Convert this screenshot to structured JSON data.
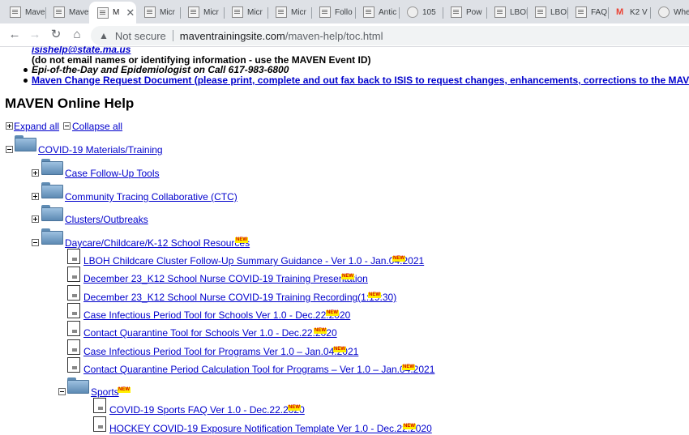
{
  "tabs": [
    {
      "label": "Mave",
      "icon": "maven-favicon-icon"
    },
    {
      "label": "Mave",
      "icon": "maven-favicon-icon"
    },
    {
      "label": "M",
      "icon": "maven-favicon-icon",
      "active": true
    },
    {
      "label": "Micr",
      "icon": "maven-favicon-icon"
    },
    {
      "label": "Micr",
      "icon": "maven-favicon-icon"
    },
    {
      "label": "Micr",
      "icon": "maven-favicon-icon"
    },
    {
      "label": "Micr",
      "icon": "maven-favicon-icon"
    },
    {
      "label": "Follo",
      "icon": "maven-favicon-icon"
    },
    {
      "label": "Antic",
      "icon": "maven-favicon-icon"
    },
    {
      "label": "105",
      "icon": "page-favicon-icon"
    },
    {
      "label": "Pow",
      "icon": "maven-favicon-icon"
    },
    {
      "label": "LBOH",
      "icon": "maven-favicon-icon"
    },
    {
      "label": "LBOH",
      "icon": "maven-favicon-icon"
    },
    {
      "label": "FAQ",
      "icon": "maven-favicon-icon"
    },
    {
      "label": "K2 V",
      "icon": "gmail-icon"
    },
    {
      "label": "Whe",
      "icon": "page-favicon-icon"
    }
  ],
  "toolbar": {
    "security_label": "Not secure",
    "url_host": "maventrainingsite.com",
    "url_path": "/maven-help/toc.html"
  },
  "header": {
    "isis_email": "isishelp@state.ma.us",
    "email_note": "(do not email names or identifying information - use the MAVEN Event ID)",
    "epi_line": "Epi-of-the-Day and Epidemiologist on Call 617-983-6800",
    "change_request": "Maven Change Request Document (please print, complete and out fax back to ISIS to request changes, enhancements, corrections to the MAVEN database"
  },
  "page": {
    "title": "MAVEN Online Help",
    "expand_all": "Expand all",
    "collapse_all": "Collapse all",
    "new_badge": "NEW"
  },
  "tree": {
    "root": "COVID-19 Materials/Training",
    "folders": [
      "Case Follow-Up Tools",
      "Community Tracing Collaborative (CTC)",
      "Clusters/Outbreaks",
      "Daycare/Childcare/K-12 School Resources"
    ],
    "daycare_docs": [
      "LBOH Childcare Cluster Follow-Up Summary Guidance - Ver 1.0 - Jan.04.2021",
      "December 23_K12 School Nurse COVID-19 Training Presentation",
      "December 23_K12 School Nurse COVID-19 Training Recording(1:19:30)",
      "Case Infectious Period Tool for Schools Ver 1.0 - Dec.22.2020",
      "Contact Quarantine Tool for Schools Ver 1.0 - Dec.22.2020",
      "Case Infectious Period Tool for Programs Ver 1.0 – Jan.04.2021",
      "Contact Quarantine Period Calculation Tool for Programs – Ver 1.0 – Jan.04.2021"
    ],
    "sports_folder": "Sports",
    "sports_docs": [
      "COVID-19 Sports FAQ Ver 1.0 - Dec.22.2020",
      "HOCKEY COVID-19 Exposure Notification Template Ver 1.0 - Dec.22.2020"
    ]
  }
}
